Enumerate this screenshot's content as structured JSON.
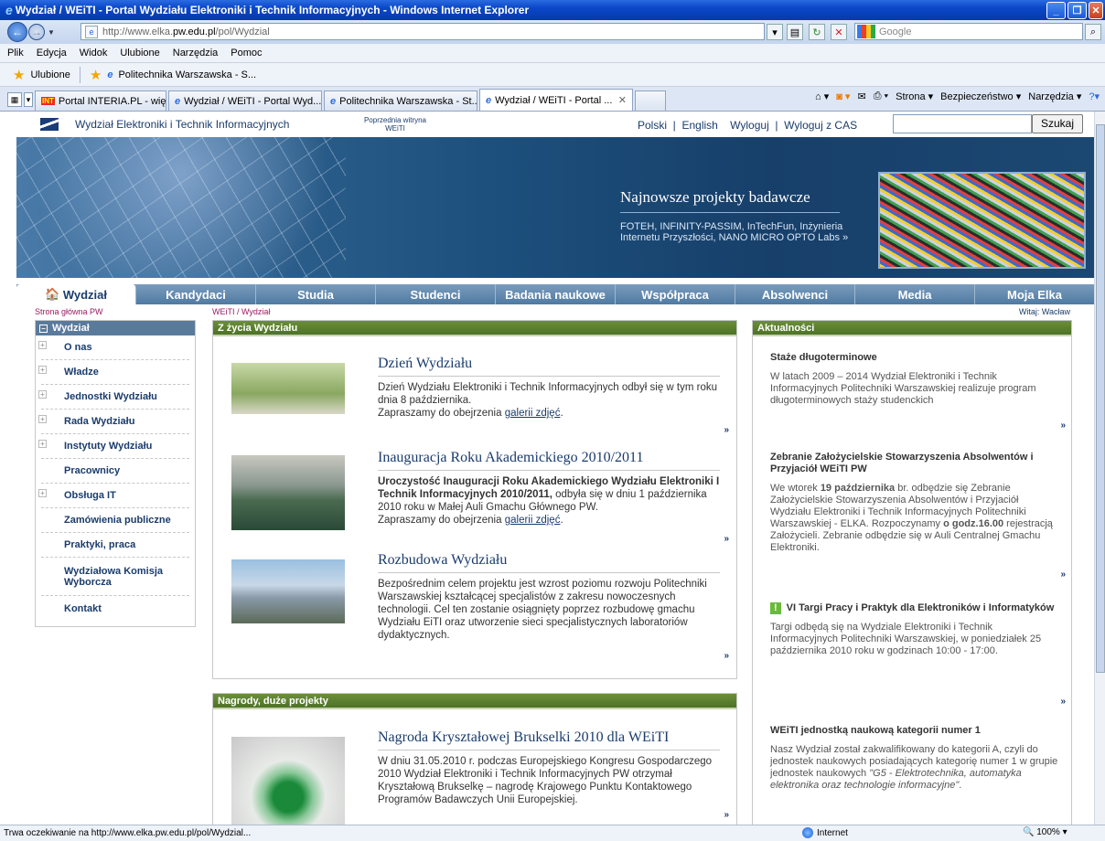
{
  "window": {
    "title": "Wydział / WEiTI - Portal Wydziału Elektroniki i Technik Informacyjnych - Windows Internet Explorer"
  },
  "address": {
    "prefix": "http://www.elka.",
    "domain": "pw.edu.pl",
    "path": "/pol/Wydzial"
  },
  "search_placeholder": "Google",
  "menu": [
    "Plik",
    "Edycja",
    "Widok",
    "Ulubione",
    "Narzędzia",
    "Pomoc"
  ],
  "favorites": {
    "label": "Ulubione",
    "item": "Politechnika Warszawska - S..."
  },
  "tabs": [
    {
      "label": "Portal INTERIA.PL - więcej ni...",
      "icon": "int"
    },
    {
      "label": "Wydział / WEiTI - Portal Wyd...",
      "icon": "e"
    },
    {
      "label": "Politechnika Warszawska - St...",
      "icon": "e"
    },
    {
      "label": "Wydział / WEiTI - Portal ...",
      "icon": "e",
      "active": true
    }
  ],
  "commands": [
    "Strona ▾",
    "Bezpieczeństwo ▾",
    "Narzędzia ▾"
  ],
  "site": {
    "name": "Wydział Elektroniki i Technik Informacyjnych",
    "prev": "Poprzednia witryna WEiTI",
    "langs": "Polski  |  English    Wyloguj  |  Wyloguj z CAS",
    "search_button": "Szukaj"
  },
  "banner": {
    "title": "Najnowsze projekty badawcze",
    "text": "FOTEH, INFINITY-PASSIM, InTechFun, Inżynieria Internetu Przyszłości, NANO MICRO OPTO Labs »"
  },
  "nav": [
    "Wydział",
    "Kandydaci",
    "Studia",
    "Studenci",
    "Badania naukowe",
    "Współpraca",
    "Absolwenci",
    "Media",
    "Moja Elka"
  ],
  "subrow": {
    "home": "Strona główna PW",
    "breadcrumb": "WEiTI / Wydział",
    "welcome": "Witaj: Wacław"
  },
  "sidebar": {
    "title": "Wydział",
    "items": [
      "O nas",
      "Władze",
      "Jednostki Wydziału",
      "Rada Wydziału",
      "Instytuty Wydziału",
      "Pracownicy",
      "Obsługa IT",
      "Zamówienia publiczne",
      "Praktyki, praca",
      "Wydziałowa Komisja Wyborcza",
      "Kontakt"
    ]
  },
  "life": {
    "title": "Z życia Wydziału",
    "articles": [
      {
        "title": "Dzień Wydziału",
        "text": "Dzień Wydziału Elektroniki i Technik Informacyjnych odbył się w tym roku dnia 8 października.",
        "more_text": "Zapraszamy do obejrzenia ",
        "link": "galerii zdjęć",
        "after": "."
      },
      {
        "title": "Inauguracja Roku Akademickiego 2010/2011",
        "bold": "Uroczystość Inauguracji Roku Akademickiego Wydziału Elektroniki I Technik Informacyjnych 2010/2011,",
        "text": " odbyła się w dniu 1 października 2010 roku w Małej Auli Gmachu Głównego PW.",
        "more_text": "Zapraszamy do obejrzenia ",
        "link": "galerii zdjęć",
        "after": "."
      },
      {
        "title": "Rozbudowa Wydziału",
        "text": "Bezpośrednim celem projektu jest wzrost poziomu rozwoju Politechniki Warszawskiej kształcącej specjalistów z zakresu nowoczesnych technologii. Cel ten zostanie osiągnięty poprzez rozbudowę gmachu Wydziału EiTI oraz utworzenie sieci specjalistycznych laboratoriów dydaktycznych."
      }
    ]
  },
  "awards": {
    "title": "Nagrody, duże projekty",
    "article": {
      "title": "Nagroda Kryształowej Brukselki 2010 dla WEiTI",
      "text": "W dniu 31.05.2010 r. podczas Europejskiego Kongresu Gospodarczego 2010 Wydział Elektroniki i Technik Informacyjnych PW otrzymał Kryształową Brukselkę – nagrodę Krajowego Punktu Kontaktowego Programów Badawczych Unii Europejskiej."
    }
  },
  "news": {
    "title": "Aktualności",
    "items": [
      {
        "title": "Staże długoterminowe",
        "text": "W latach 2009 – 2014 Wydział Elektroniki i Technik Informacyjnych Politechniki Warszawskiej realizuje program długoterminowych staży studenckich"
      },
      {
        "title": "Zebranie Założycielskie Stowarzyszenia Absolwentów i Przyjaciół WEiTI PW",
        "t1": "We wtorek ",
        "b1": "19 października",
        "t2": " br. odbędzie się Zebranie Założycielskie Stowarzyszenia Absolwentów i Przyjaciół Wydziału Elektroniki i Technik Informacyjnych Politechniki Warszawskiej - ELKA. Rozpoczynamy ",
        "b2": "o godz.16.00",
        "t3": " rejestracją Założycieli. Zebranie odbędzie się w Auli Centralnej Gmachu Elektroniki."
      },
      {
        "title": "VI Targi Pracy i Praktyk dla Elektroników i Informatyków",
        "text": "Targi odbędą się na Wydziale Elektroniki i Technik Informacyjnych Politechniki Warszawskiej, w poniedziałek 25 października 2010 roku w godzinach 10:00 - 17:00."
      },
      {
        "title": "WEiTI jednostką naukową kategorii numer 1",
        "text": "Nasz Wydział został zakwalifikowany do kategorii A, czyli do jednostek naukowych posiadających kategorię numer 1 w grupie jednostek naukowych ",
        "italic": "\"G5 - Elektrotechnika, automatyka elektronika oraz technologie informacyjne\"",
        "after": "."
      }
    ]
  },
  "more": "»",
  "status": {
    "text": "Trwa oczekiwanie na http://www.elka.pw.edu.pl/pol/Wydzial...",
    "zone": "Internet",
    "zoom": "100%"
  }
}
